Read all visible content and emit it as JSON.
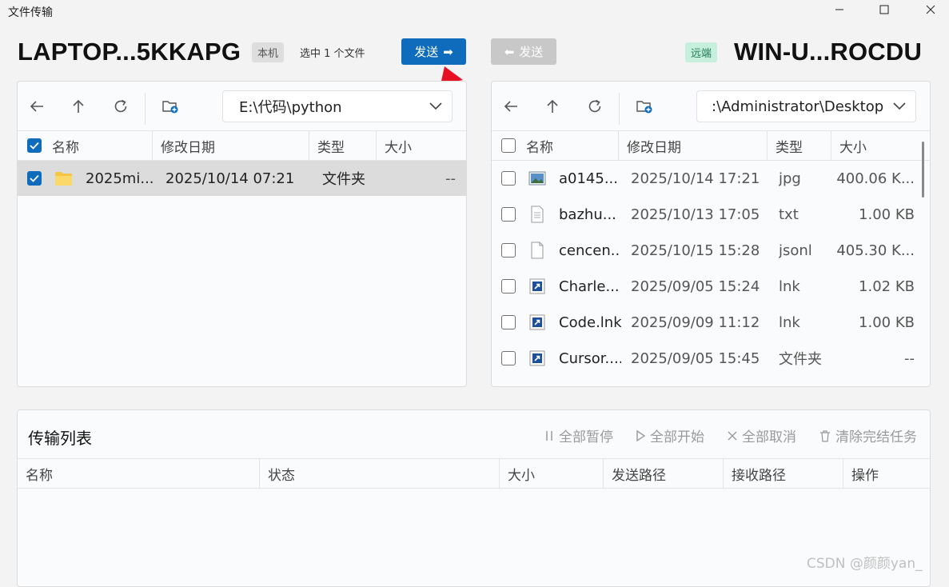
{
  "window": {
    "title": "文件传输",
    "minimize": "—",
    "maximize": "☐",
    "close": "✕"
  },
  "header": {
    "local_host": "LAPTOP...5KKAPG",
    "local_badge": "本机",
    "selection_text": "选中 1 个文件",
    "send_label": "发送",
    "send_arrow": "➡",
    "receive_label": "发送",
    "receive_arrow": "⬅",
    "remote_badge": "远端",
    "remote_host": "WIN-U...ROCDU"
  },
  "local": {
    "path": "E:\\代码\\python",
    "columns": {
      "name": "名称",
      "modified": "修改日期",
      "type": "类型",
      "size": "大小"
    },
    "header_checked": true,
    "rows": [
      {
        "name": "2025mi...",
        "modified": "2025/10/14 07:21",
        "type": "文件夹",
        "size": "--",
        "icon": "folder-icon",
        "checked": true,
        "selected": true
      }
    ]
  },
  "remote": {
    "path": ":\\Administrator\\Desktop",
    "columns": {
      "name": "名称",
      "modified": "修改日期",
      "type": "类型",
      "size": "大小"
    },
    "header_checked": false,
    "rows": [
      {
        "name": "a0145...",
        "modified": "2025/10/14 17:21",
        "type": "jpg",
        "size": "400.06 K...",
        "icon": "image-file-icon",
        "checked": false
      },
      {
        "name": "bazhu...",
        "modified": "2025/10/13 17:05",
        "type": "txt",
        "size": "1.00 KB",
        "icon": "text-file-icon",
        "checked": false
      },
      {
        "name": "cencen...",
        "modified": "2025/10/15 15:28",
        "type": "jsonl",
        "size": "405.30 K...",
        "icon": "generic-file-icon",
        "checked": false
      },
      {
        "name": "Charle...",
        "modified": "2025/09/05 15:24",
        "type": "lnk",
        "size": "1.02 KB",
        "icon": "shortcut-icon",
        "checked": false
      },
      {
        "name": "Code.lnk",
        "modified": "2025/09/09 11:12",
        "type": "lnk",
        "size": "1.00 KB",
        "icon": "shortcut-icon",
        "checked": false
      },
      {
        "name": "Cursor....",
        "modified": "2025/09/05 15:45",
        "type": "文件夹",
        "size": "--",
        "icon": "shortcut-icon",
        "checked": false
      }
    ]
  },
  "transfer": {
    "title": "传输列表",
    "actions": {
      "pause_all": "全部暂停",
      "start_all": "全部开始",
      "cancel_all": "全部取消",
      "clear_done": "清除完结任务"
    },
    "columns": {
      "name": "名称",
      "status": "状态",
      "size": "大小",
      "send_path": "发送路径",
      "recv_path": "接收路径",
      "ops": "操作"
    }
  },
  "watermark": "CSDN @颜颜yan_",
  "colors": {
    "accent": "#0f6cbd",
    "remote_badge_bg": "#c6efdd",
    "annotation_arrow": "#e81123"
  }
}
